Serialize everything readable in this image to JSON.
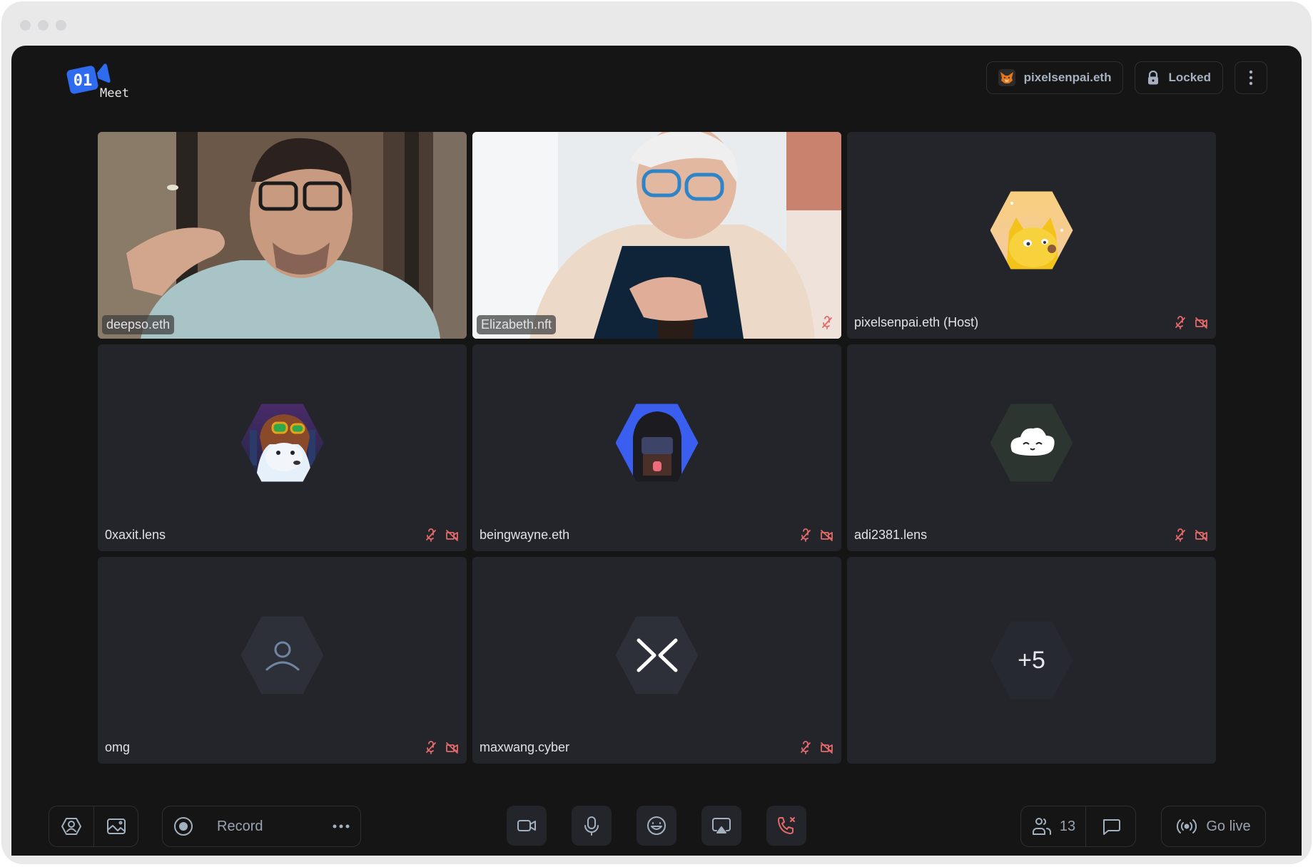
{
  "app": {
    "name": "01 Meet",
    "logo_badge": "01",
    "logo_text": "Meet",
    "accent_color": "#2f6bef",
    "danger_color": "#e46a6a"
  },
  "header": {
    "account_label": "pixelsenpai.eth",
    "account_icon": "metamask-fox-icon",
    "lock_label": "Locked",
    "lock_icon": "lock-icon",
    "more_icon": "more-vertical-icon"
  },
  "participants": [
    {
      "name": "deepso.eth",
      "type": "video",
      "active": true,
      "mic_muted": false,
      "cam_off": false
    },
    {
      "name": "Elizabeth.nft",
      "type": "video",
      "active": false,
      "mic_muted": true,
      "cam_off": false
    },
    {
      "name": "pixelsenpai.eth (Host)",
      "type": "avatar",
      "avatar": "yellow-pixel-dog",
      "mic_muted": true,
      "cam_off": true
    },
    {
      "name": "0xaxit.lens",
      "type": "avatar",
      "avatar": "pixel-dog-with-goggles",
      "mic_muted": true,
      "cam_off": true
    },
    {
      "name": "beingwayne.eth",
      "type": "avatar",
      "avatar": "pixel-hooded-character",
      "mic_muted": true,
      "cam_off": true
    },
    {
      "name": "adi2381.lens",
      "type": "avatar",
      "avatar": "smiling-cloud",
      "mic_muted": true,
      "cam_off": true
    },
    {
      "name": "omg",
      "type": "placeholder",
      "avatar": "user-icon",
      "mic_muted": true,
      "cam_off": true
    },
    {
      "name": "maxwang.cyber",
      "type": "placeholder",
      "avatar": "cyberconnect-logo",
      "mic_muted": true,
      "cam_off": true
    }
  ],
  "overflow_tile": {
    "label": "+5"
  },
  "toolbar": {
    "avatar_button_icon": "user-hexagon-icon",
    "background_button_icon": "image-icon",
    "record_label": "Record",
    "record_icon": "record-icon",
    "record_more_icon": "more-horizontal-icon",
    "camera_icon": "video-camera-icon",
    "mic_icon": "microphone-icon",
    "reaction_icon": "emoji-icon",
    "share_icon": "screen-share-icon",
    "leave_icon": "end-call-icon",
    "participants_count": "13",
    "participants_icon": "users-icon",
    "chat_icon": "chat-icon",
    "go_live_label": "Go live",
    "go_live_icon": "broadcast-icon"
  }
}
